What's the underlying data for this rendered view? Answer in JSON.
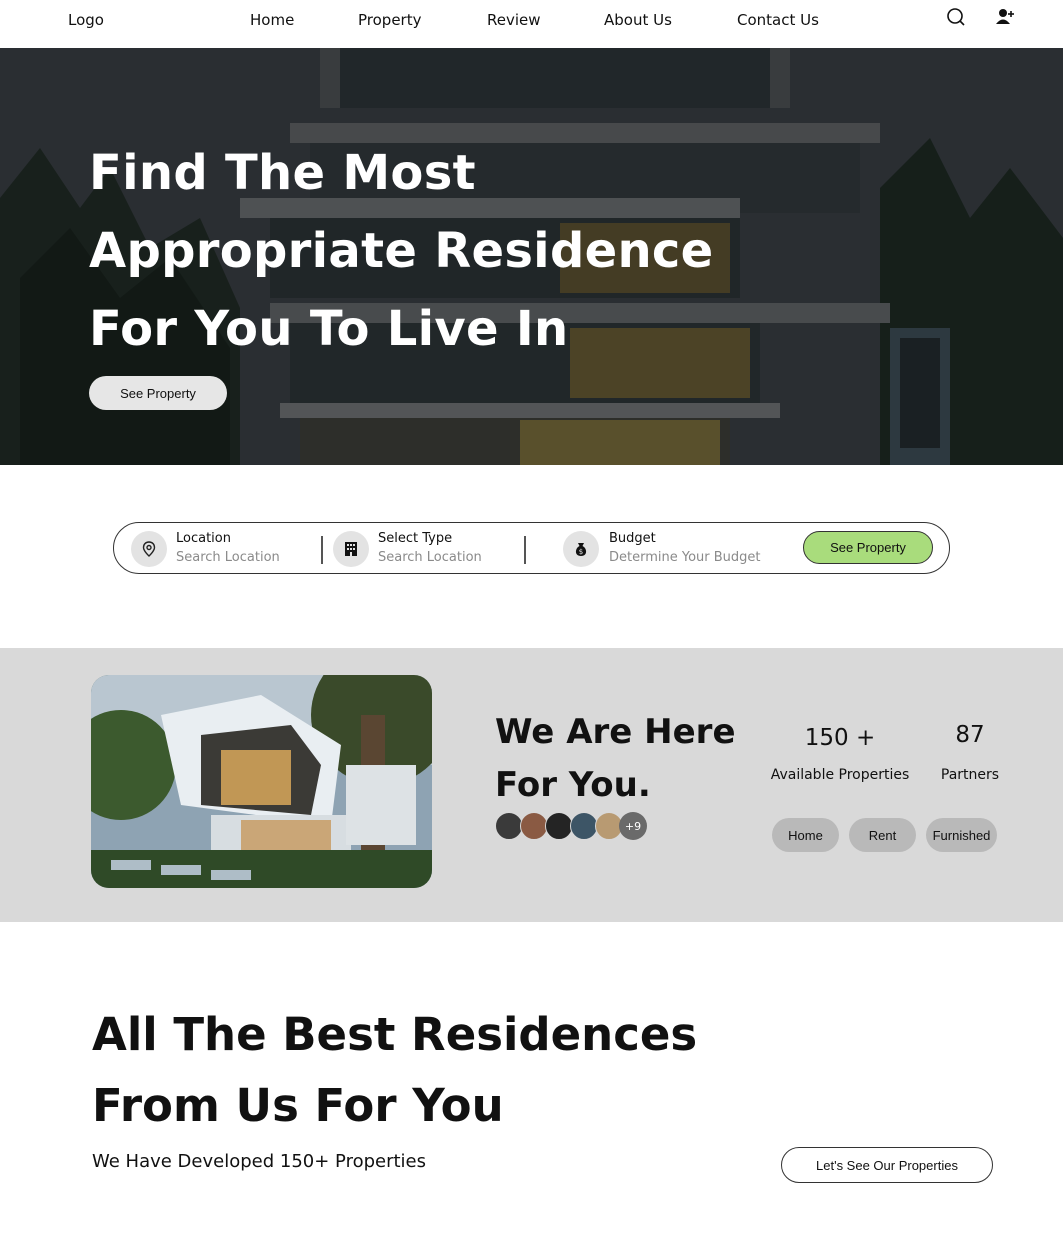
{
  "nav": {
    "logo": "Logo",
    "links": [
      "Home",
      "Property",
      "Review",
      "About Us",
      "Contact Us"
    ]
  },
  "hero": {
    "title_lines": [
      "Find The Most",
      "Appropriate Residence",
      "For You To Live In"
    ],
    "cta": "See Property"
  },
  "search": {
    "location_label": "Location",
    "location_placeholder": "Search Location",
    "type_label": "Select Type",
    "type_placeholder": "Search Location",
    "budget_label": "Budget",
    "budget_placeholder": "Determine Your Budget",
    "cta": "See Property",
    "accent": "#a9dc7c"
  },
  "about": {
    "title_lines": [
      "We Are Here",
      "For You."
    ],
    "avatars_more": "+9",
    "stats": [
      {
        "value": "150 +",
        "label": "Available Properties"
      },
      {
        "value": "87",
        "label": "Partners"
      }
    ],
    "chips": [
      "Home",
      "Rent",
      "Furnished"
    ]
  },
  "residences": {
    "title_lines": [
      "All The Best Residences",
      "From Us For You"
    ],
    "subtitle": "We Have Developed 150+ Properties",
    "cta": "Let's See Our Properties"
  }
}
